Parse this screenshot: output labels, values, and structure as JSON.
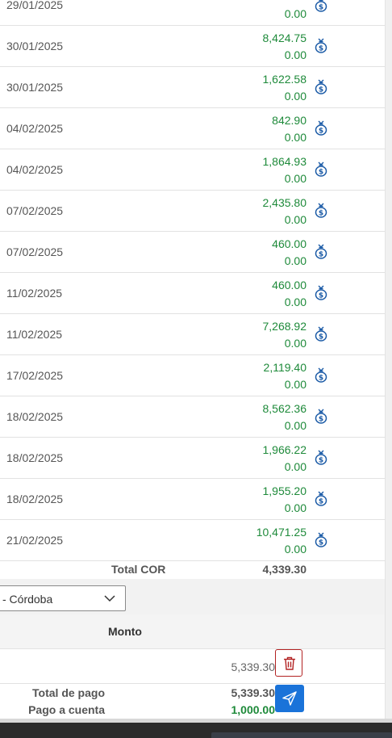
{
  "rows": [
    {
      "date": "29/01/2025",
      "v1": "",
      "v2": "0.00"
    },
    {
      "date": "30/01/2025",
      "v1": "8,424.75",
      "v2": "0.00"
    },
    {
      "date": "30/01/2025",
      "v1": "1,622.58",
      "v2": "0.00"
    },
    {
      "date": "04/02/2025",
      "v1": "842.90",
      "v2": "0.00"
    },
    {
      "date": "04/02/2025",
      "v1": "1,864.93",
      "v2": "0.00"
    },
    {
      "date": "07/02/2025",
      "v1": "2,435.80",
      "v2": "0.00"
    },
    {
      "date": "07/02/2025",
      "v1": "460.00",
      "v2": "0.00"
    },
    {
      "date": "11/02/2025",
      "v1": "460.00",
      "v2": "0.00"
    },
    {
      "date": "11/02/2025",
      "v1": "7,268.92",
      "v2": "0.00"
    },
    {
      "date": "17/02/2025",
      "v1": "2,119.40",
      "v2": "0.00"
    },
    {
      "date": "18/02/2025",
      "v1": "8,562.36",
      "v2": "0.00"
    },
    {
      "date": "18/02/2025",
      "v1": "1,966.22",
      "v2": "0.00"
    },
    {
      "date": "18/02/2025",
      "v1": "1,955.20",
      "v2": "0.00"
    },
    {
      "date": "21/02/2025",
      "v1": "10,471.25",
      "v2": "0.00"
    }
  ],
  "row_icon": "money-bag-icon",
  "total": {
    "label": "Total COR",
    "value": "4,339.30"
  },
  "currency_select": {
    "value": "- Córdoba"
  },
  "payment_table": {
    "header": "Monto",
    "amount": "5,339.30"
  },
  "footer": {
    "total_label": "Total de pago",
    "total_value": "5,339.30",
    "account_label": "Pago a cuenta",
    "account_value": "1,000.00"
  },
  "colors": {
    "positive": "#1e8a3a",
    "primary": "#1a73d9",
    "danger": "#b22222",
    "icon": "#1a5aa6"
  }
}
